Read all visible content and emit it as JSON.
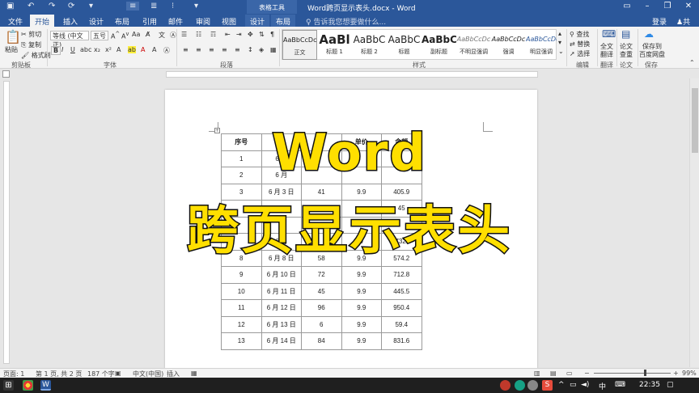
{
  "title": {
    "document": "Word跨页显示表头.docx - Word",
    "context_tab": "表格工具"
  },
  "tabs": [
    "文件",
    "开始",
    "插入",
    "设计",
    "布局",
    "引用",
    "邮件",
    "审阅",
    "视图",
    "设计",
    "布局"
  ],
  "tell_me": "告诉我您想要做什么...",
  "account": {
    "login": "登录",
    "share": "共享"
  },
  "ribbon": {
    "clipboard": {
      "paste": "粘贴",
      "cut": "剪切",
      "copy": "复制",
      "format_painter": "格式刷",
      "label": "剪贴板"
    },
    "font": {
      "name": "等线 (中文正)",
      "size": "五号",
      "label": "字体"
    },
    "paragraph": {
      "label": "段落"
    },
    "styles": {
      "label": "样式",
      "items": [
        {
          "preview": "AaBbCcDc",
          "name": "正文"
        },
        {
          "preview": "AaBl",
          "name": "标题 1"
        },
        {
          "preview": "AaBbC",
          "name": "标题 2"
        },
        {
          "preview": "AaBbC",
          "name": "标题"
        },
        {
          "preview": "AaBbC",
          "name": "副标题"
        },
        {
          "preview": "AaBbCcDc",
          "name": "不明显强调"
        },
        {
          "preview": "AaBbCcDc",
          "name": "强调"
        },
        {
          "preview": "AaBbCcDc",
          "name": "明显强调"
        }
      ]
    },
    "editing": {
      "find": "查找",
      "replace": "替换",
      "select": "选择",
      "label": "编辑"
    },
    "fulltext": {
      "l1": "全文",
      "l2": "翻译",
      "label": "翻译"
    },
    "thesis": {
      "l1": "论文",
      "l2": "查重",
      "label": "论文"
    },
    "baidu": {
      "l1": "保存到",
      "l2": "百度网盘",
      "label": "保存"
    }
  },
  "table": {
    "headers": [
      "序号",
      "",
      "",
      "单价",
      "金额"
    ],
    "rows": [
      [
        "1",
        "6 月",
        "",
        "",
        ""
      ],
      [
        "2",
        "6 月",
        "",
        "",
        ""
      ],
      [
        "3",
        "6 月 3 日",
        "41",
        "9.9",
        "405.9"
      ],
      [
        "",
        "",
        "",
        "",
        "45"
      ],
      [
        "",
        "",
        "",
        "",
        ""
      ],
      [
        "",
        "6 月",
        "",
        "9",
        "732."
      ],
      [
        "8",
        "6 月 8 日",
        "58",
        "9.9",
        "574.2"
      ],
      [
        "9",
        "6 月 10 日",
        "72",
        "9.9",
        "712.8"
      ],
      [
        "10",
        "6 月 11 日",
        "45",
        "9.9",
        "445.5"
      ],
      [
        "11",
        "6 月 12 日",
        "96",
        "9.9",
        "950.4"
      ],
      [
        "12",
        "6 月 13 日",
        "6",
        "9.9",
        "59.4"
      ],
      [
        "13",
        "6 月 14 日",
        "84",
        "9.9",
        "831.6"
      ]
    ]
  },
  "overlay": {
    "line1": "Word",
    "line2": "跨页显示表头"
  },
  "status": {
    "page": "页面: 1",
    "section": "第 1 页, 共 2 页",
    "words": "187 个字",
    "lang": "中文(中国)",
    "mode": "插入",
    "zoom": "99%"
  },
  "taskbar": {
    "ime": "中",
    "time": "22:35"
  },
  "colors": {
    "word_blue": "#2b579a",
    "overlay_yellow": "#ffdf00"
  }
}
